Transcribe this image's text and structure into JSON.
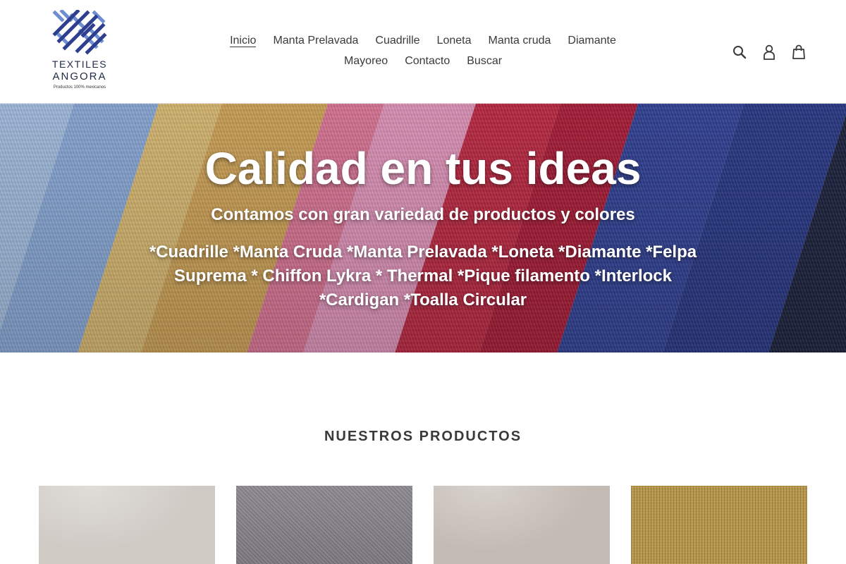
{
  "brand": {
    "name_line1": "TEXTILES",
    "name_line2": "ANGORA",
    "tagline": "Productos 100% mexicanos",
    "logo_icon": "woven-x-logo-icon",
    "colors": {
      "dark": "#2e3f8f",
      "light": "#6f8ed0"
    }
  },
  "nav": {
    "row1": [
      "Inicio",
      "Manta Prelavada",
      "Cuadrille",
      "Loneta",
      "Manta cruda",
      "Diamante"
    ],
    "row2": [
      "Mayoreo",
      "Contacto",
      "Buscar"
    ],
    "active": "Inicio"
  },
  "header_icons": [
    "search-icon",
    "account-icon",
    "cart-icon"
  ],
  "hero": {
    "title": "Calidad en tus ideas",
    "subtitle": "Contamos con gran variedad de productos y colores",
    "body": "*Cuadrille *Manta Cruda *Manta Prelavada *Loneta *Diamante *Felpa Suprema * Chiffon Lykra * Thermal *Pique filamento *Interlock *Cardigan *Toalla Circular",
    "stripe_colors": [
      "#e8d6e6",
      "#a9c6ea",
      "#8fb0e0",
      "#e2c177",
      "#d7a95a",
      "#e47a9c",
      "#ea9ac2",
      "#c42a45",
      "#b01d3a",
      "#33449c",
      "#2a3a8a",
      "#1d2340",
      "#15192b"
    ]
  },
  "products": {
    "title": "NUESTROS PRODUCTOS",
    "cards": [
      {
        "color": "#cfcac4",
        "texture": "cotton"
      },
      {
        "color": "#8e8a91",
        "texture": "twill"
      },
      {
        "color": "#c3bab3",
        "texture": "cotton"
      },
      {
        "color": "#b8964a",
        "texture": "canvas"
      }
    ]
  }
}
